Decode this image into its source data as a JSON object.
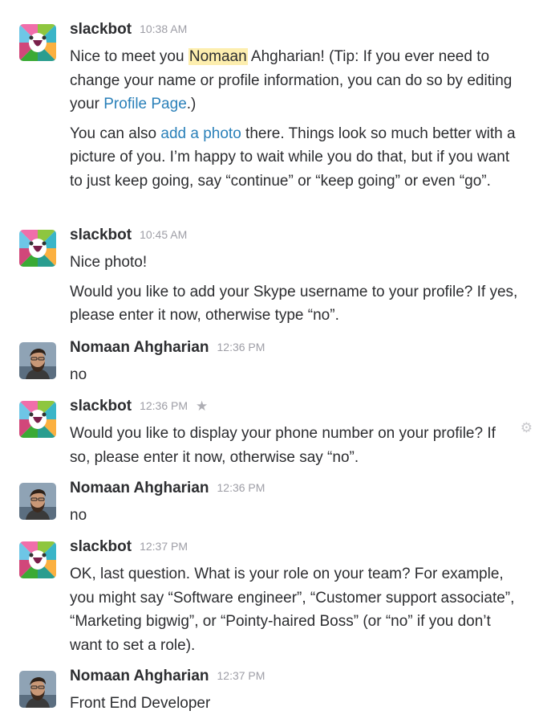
{
  "messages": [
    {
      "sender": "slackbot",
      "time": "10:38 AM",
      "paragraphs": [
        {
          "pre": "Nice to meet you ",
          "mention": "Nomaan",
          "mid": " Ahgharian! (Tip: If you ever need to change your name or profile information, you can do so by editing your ",
          "link": "Profile Page",
          "post": ".)"
        },
        {
          "pre": "You can also ",
          "link": "add a photo",
          "post": " there. Things look so much better with a picture of you. I’m happy to wait while you do that, but if you want to just keep going, say “continue” or “keep going” or even “go”."
        }
      ]
    },
    {
      "sender": "slackbot",
      "time": "10:45 AM",
      "paragraphs": [
        "Nice photo!",
        "Would you like to add your Skype username to your profile?  If yes, please enter it now, otherwise type “no”."
      ]
    },
    {
      "sender": "Nomaan Ahgharian",
      "time": "12:36 PM",
      "paragraphs": [
        "no"
      ]
    },
    {
      "sender": "slackbot",
      "time": "12:36 PM",
      "star_icon": "star-icon",
      "gear_icon": "gear-icon",
      "paragraphs": [
        "Would you like to display your phone number on your profile? If so, please enter it now, otherwise say “no”."
      ]
    },
    {
      "sender": "Nomaan Ahgharian",
      "time": "12:36 PM",
      "paragraphs": [
        "no"
      ]
    },
    {
      "sender": "slackbot",
      "time": "12:37 PM",
      "paragraphs": [
        "OK, last question. What is your role on your team? For example, you might say “Software engineer”, “Customer support associate”, “Marketing bigwig”, or “Pointy-haired Boss” (or “no” if you don’t want to set a role)."
      ]
    },
    {
      "sender": "Nomaan Ahgharian",
      "time": "12:37 PM",
      "paragraphs": [
        "Front End Developer"
      ]
    }
  ],
  "colors": {
    "link": "#2a80b9",
    "mention_bg": "#fdeeae",
    "timestamp": "#9e9ea6",
    "text": "#2c2d30"
  }
}
